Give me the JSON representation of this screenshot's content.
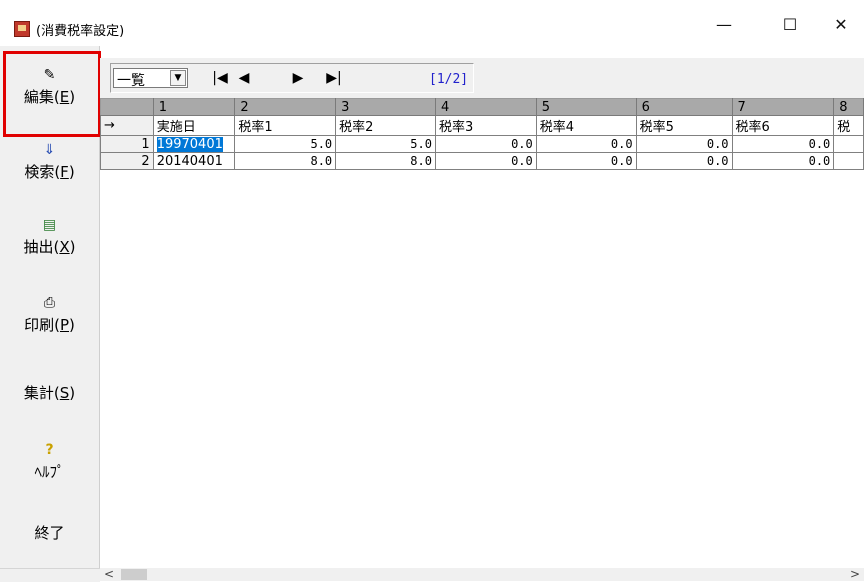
{
  "window": {
    "title": "(消費税率設定)",
    "minimize": "—",
    "maximize": "☐",
    "close": "✕"
  },
  "sidebar": {
    "items": [
      {
        "label": "編集(",
        "key": "E",
        "icon": "edit-icon",
        "glyph": "✎"
      },
      {
        "label": "検索(",
        "key": "F",
        "icon": "search-arrow-icon",
        "glyph": "⇓"
      },
      {
        "label": "抽出(",
        "key": "X",
        "icon": "extract-icon",
        "glyph": "▤"
      },
      {
        "label": "印刷(",
        "key": "P",
        "icon": "printer-icon",
        "glyph": "⎙"
      },
      {
        "label": "集計(",
        "key": "S",
        "icon": "",
        "glyph": ""
      },
      {
        "label": "ﾍﾙﾌﾟ",
        "key": "",
        "icon": "help-icon",
        "glyph": "?"
      },
      {
        "label": "終了",
        "key": "",
        "icon": "",
        "glyph": ""
      }
    ]
  },
  "toolbar": {
    "view_select_value": "一覧",
    "nav_first": "|◀",
    "nav_prev": "◀",
    "nav_next": "▶",
    "nav_last": "▶|",
    "page_indicator": "[1/2]"
  },
  "grid": {
    "column_numbers": [
      "",
      "1",
      "2",
      "3",
      "4",
      "5",
      "6",
      "7",
      "8"
    ],
    "corner_arrow": "→",
    "headers": [
      "実施日",
      "税率1",
      "税率2",
      "税率3",
      "税率4",
      "税率5",
      "税率6",
      "税"
    ],
    "rows": [
      {
        "num": "1",
        "cells": [
          "19970401",
          "5.0",
          "5.0",
          "0.0",
          "0.0",
          "0.0",
          "0.0",
          ""
        ]
      },
      {
        "num": "2",
        "cells": [
          "20140401",
          "8.0",
          "8.0",
          "0.0",
          "0.0",
          "0.0",
          "0.0",
          ""
        ]
      }
    ]
  },
  "colors": {
    "highlight_border": "#e00000",
    "selection": "#0078d7",
    "page_indicator": "#2222cc"
  }
}
